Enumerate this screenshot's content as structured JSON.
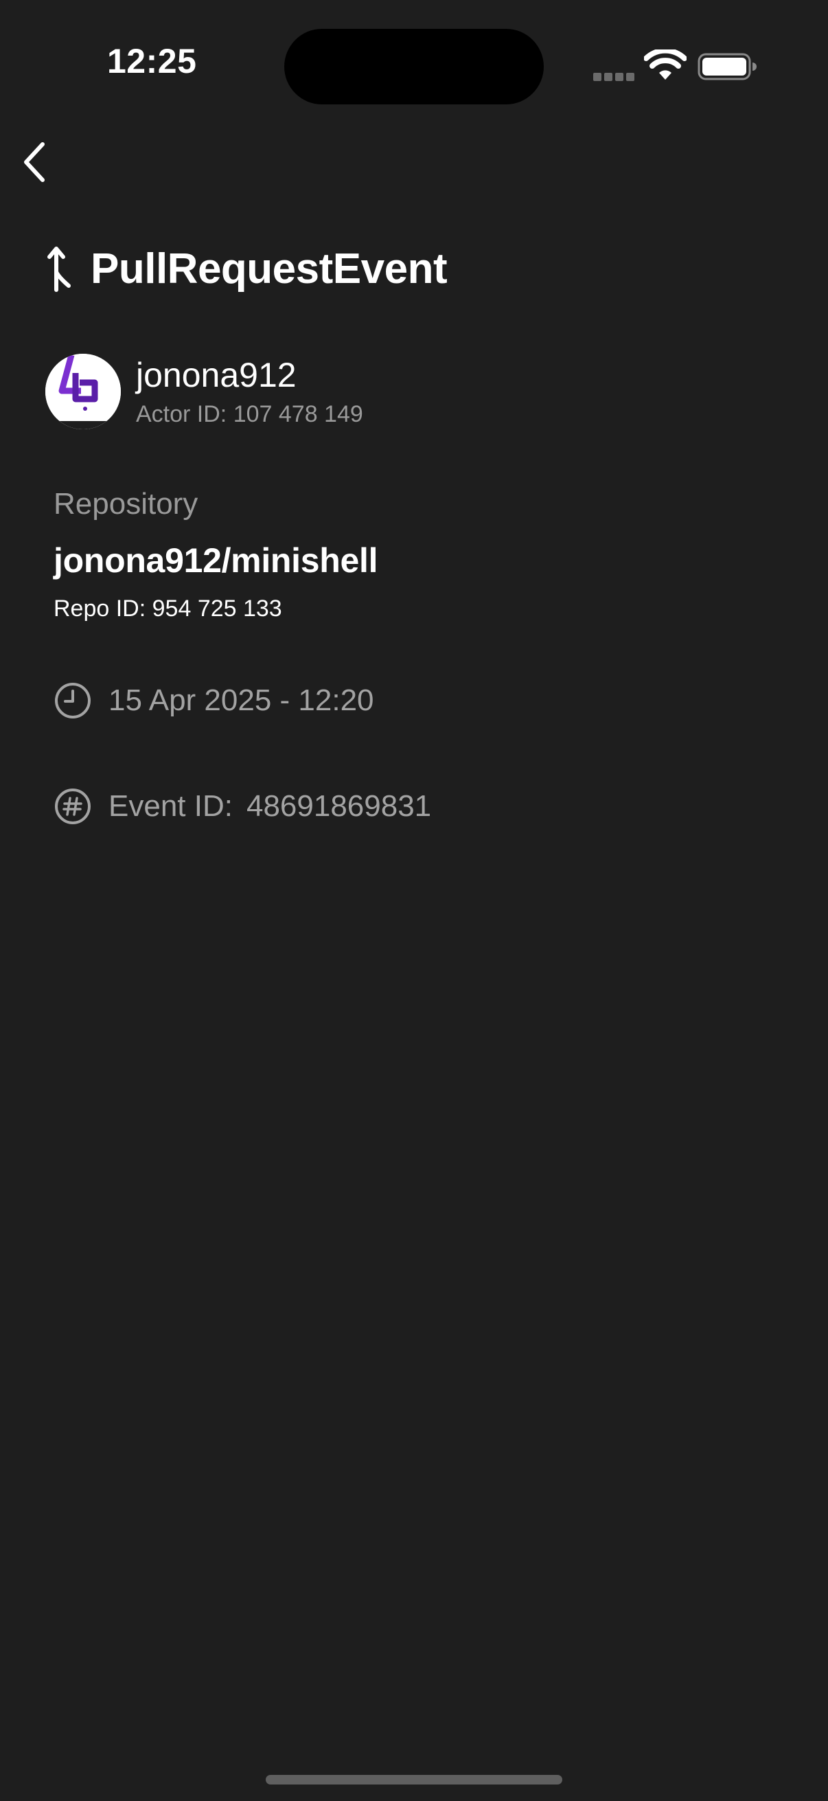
{
  "status_bar": {
    "time": "12:25"
  },
  "nav": {
    "back_icon": "chevron-left-icon"
  },
  "header": {
    "icon": "pull-request-icon",
    "title": "PullRequestEvent"
  },
  "actor": {
    "username": "jonona912",
    "id_label": "Actor ID:",
    "id_value": "107 478 149"
  },
  "repository": {
    "section_label": "Repository",
    "name": "jonona912/minishell",
    "id_label": "Repo ID:",
    "id_value": "954 725 133"
  },
  "meta": {
    "date_icon": "clock-icon",
    "date": "15 Apr 2025 - 12:20",
    "event_icon": "hash-icon",
    "event_id_label": "Event ID:",
    "event_id_value": "48691869831"
  },
  "colors": {
    "background": "#1e1e1e",
    "secondary_text": "#9a9a9a",
    "avatar_purple": "#7b2fd0"
  }
}
